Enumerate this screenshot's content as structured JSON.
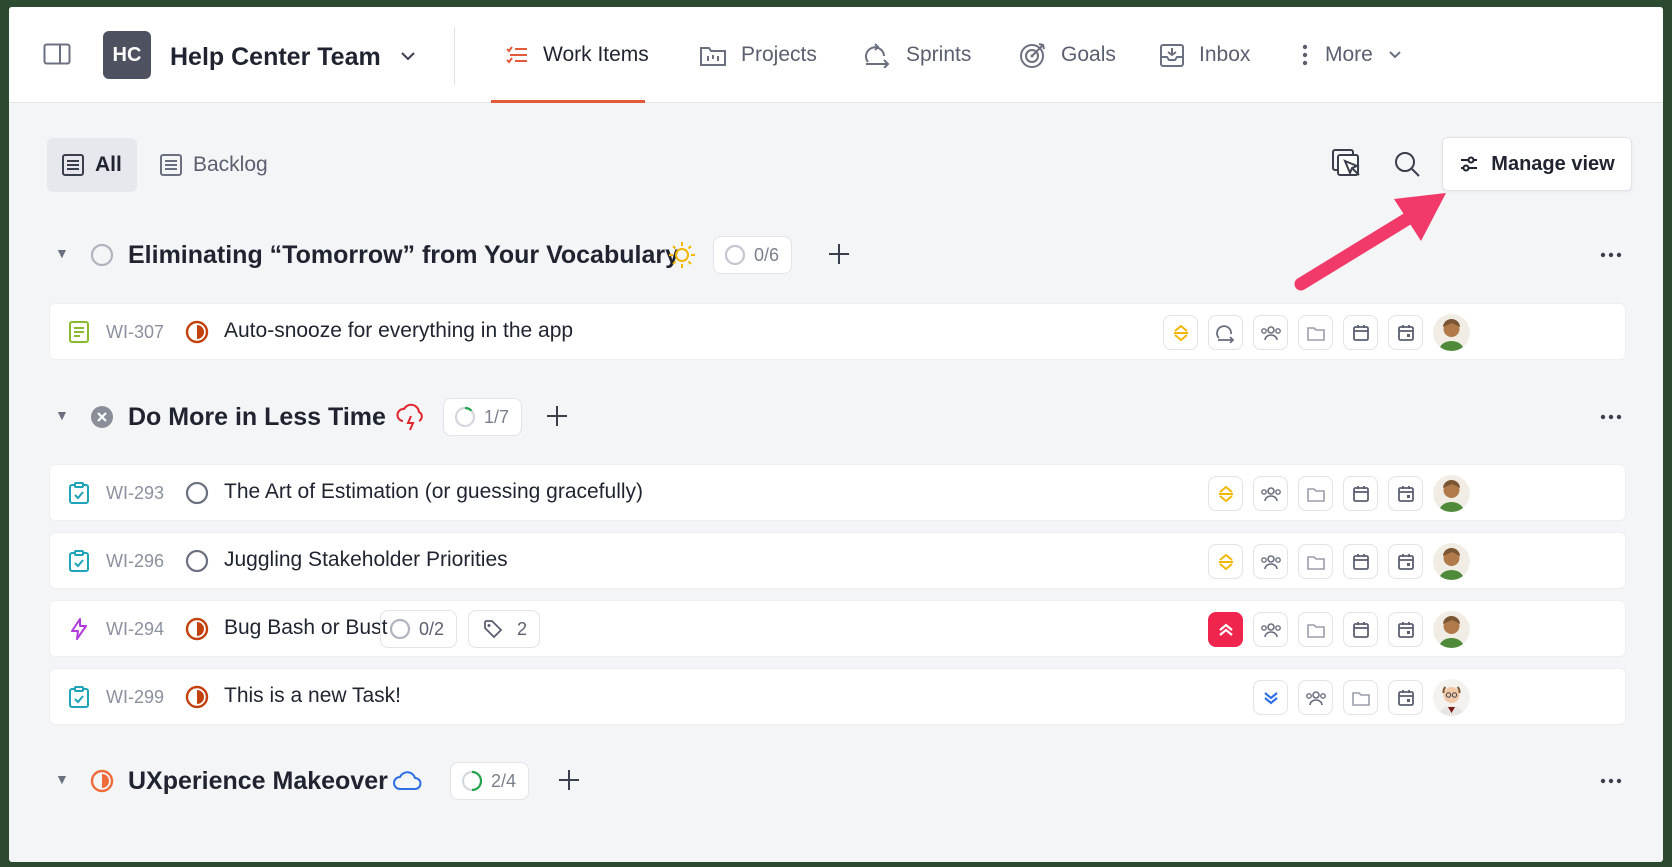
{
  "header": {
    "team_initials": "HC",
    "team_name": "Help Center Team",
    "nav": [
      {
        "label": "Work Items",
        "icon": "work-items-icon",
        "active": true
      },
      {
        "label": "Projects",
        "icon": "projects-icon"
      },
      {
        "label": "Sprints",
        "icon": "sprints-icon"
      },
      {
        "label": "Goals",
        "icon": "goals-icon"
      },
      {
        "label": "Inbox",
        "icon": "inbox-icon"
      },
      {
        "label": "More",
        "icon": "more-vertical-icon"
      }
    ]
  },
  "toolbar": {
    "views": [
      {
        "label": "All",
        "active": true
      },
      {
        "label": "Backlog"
      }
    ],
    "manage_view_label": "Manage view"
  },
  "groups": [
    {
      "title": "Eliminating “Tomorrow” from Your Vocabulary",
      "progress": "0/6",
      "emoji": "sun-icon"
    },
    {
      "title": "Do More in Less Time",
      "progress": "1/7",
      "emoji": "storm-cloud-icon"
    },
    {
      "title": "UXperience Makeover",
      "progress": "2/4",
      "emoji": "cloud-icon"
    }
  ],
  "rows": [
    {
      "id": "WI-307",
      "title": "Auto-snooze for everything in the app",
      "type": "story",
      "status": "in-progress",
      "priority": "medium"
    },
    {
      "id": "WI-293",
      "title": "The Art of Estimation (or guessing gracefully)",
      "type": "task",
      "status": "todo",
      "priority": "medium"
    },
    {
      "id": "WI-296",
      "title": "Juggling Stakeholder Priorities",
      "type": "task",
      "status": "todo",
      "priority": "medium"
    },
    {
      "id": "WI-294",
      "title": "Bug Bash or Bust",
      "type": "bug",
      "status": "in-progress",
      "priority": "urgent",
      "subtasks": "0/2",
      "labels": "2"
    },
    {
      "id": "WI-299",
      "title": "This is a new Task!",
      "type": "task",
      "status": "in-progress",
      "priority": "low"
    }
  ],
  "colors": {
    "accent": "#e35a3a",
    "annotation_arrow": "#f23a6a",
    "team_avatar": "#4d5160",
    "medium_priority": "#f2b705",
    "urgent_priority": "#f0254d",
    "low_priority": "#2f6fe3"
  }
}
